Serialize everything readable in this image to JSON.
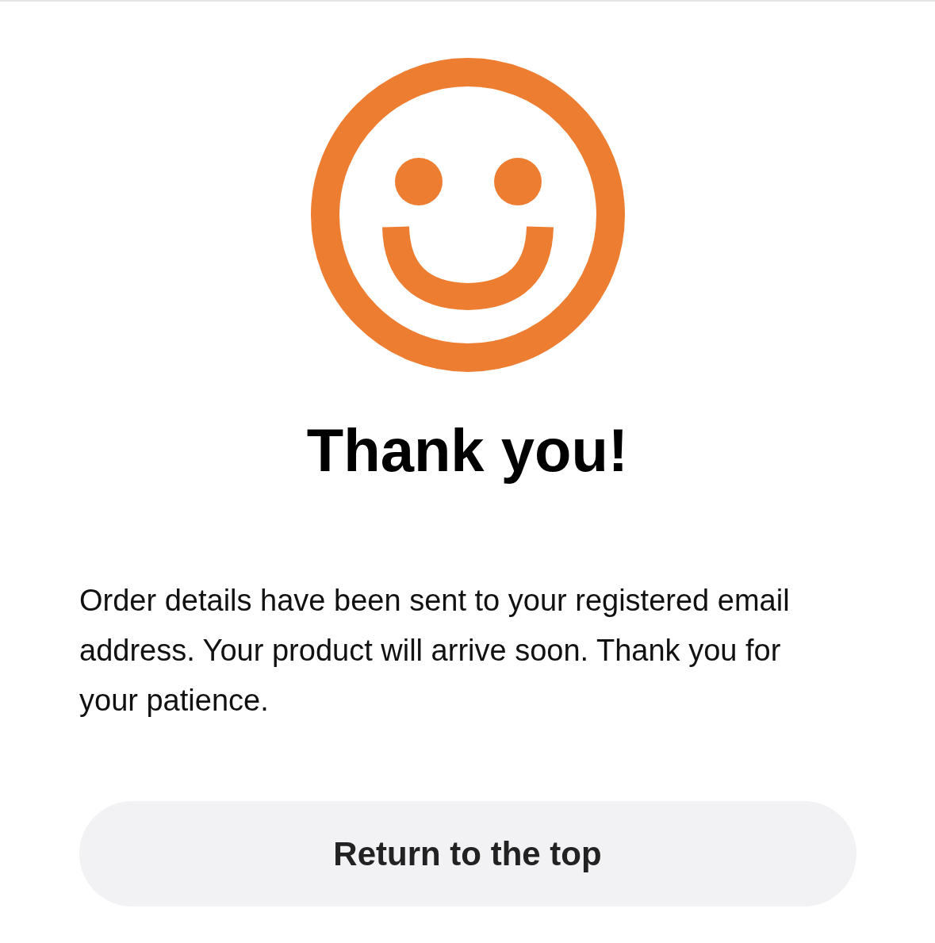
{
  "title": "Thank you!",
  "message": "Order details have been sent to your registered email address. Your product will arrive soon. Thank you for your patience.",
  "button": {
    "label": "Return to the top"
  }
}
